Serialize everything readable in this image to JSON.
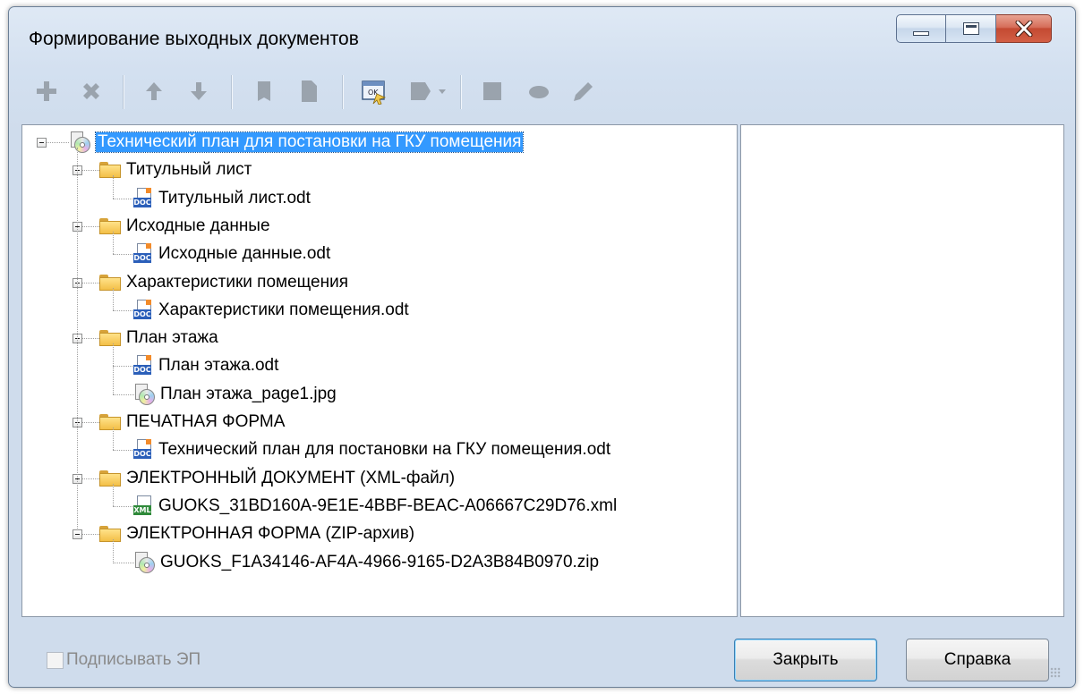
{
  "window": {
    "title": "Формирование выходных документов"
  },
  "toolbar": {
    "icons": [
      "add-icon",
      "delete-icon",
      "move-up-icon",
      "move-down-icon",
      "bookmark-icon",
      "page-icon",
      "ok-form-icon",
      "dropdown-icon",
      "square-icon",
      "stamp-icon",
      "edit-icon"
    ]
  },
  "tree": {
    "root": "Технический план для постановки на ГКУ помещения",
    "folders": [
      {
        "label": "Титульный лист",
        "files": [
          "Титульный лист.odt"
        ]
      },
      {
        "label": "Исходные данные",
        "files": [
          "Исходные данные.odt"
        ]
      },
      {
        "label": "Характеристики помещения",
        "files": [
          "Характеристики помещения.odt"
        ]
      },
      {
        "label": "План этажа",
        "files": [
          "План этажа.odt",
          "План этажа_page1.jpg"
        ]
      },
      {
        "label": "ПЕЧАТНАЯ ФОРМА",
        "files": [
          "Технический план для постановки на ГКУ помещения.odt"
        ]
      },
      {
        "label": "ЭЛЕКТРОННЫЙ ДОКУМЕНТ (XML-файл)",
        "files": [
          "GUOKS_31BD160A-9E1E-4BBF-BEAC-A06667C29D76.xml"
        ]
      },
      {
        "label": "ЭЛЕКТРОННАЯ ФОРМА (ZIP-архив)",
        "files": [
          "GUOKS_F1A34146-AF4A-4966-9165-D2A3B84B0970.zip"
        ]
      }
    ]
  },
  "footer": {
    "sign_label": "Подписывать ЭП",
    "close_label": "Закрыть",
    "help_label": "Справка"
  },
  "colors": {
    "selection": "#3399ff",
    "window_bg": "#cfdcec",
    "close_button": "#c44a32"
  }
}
